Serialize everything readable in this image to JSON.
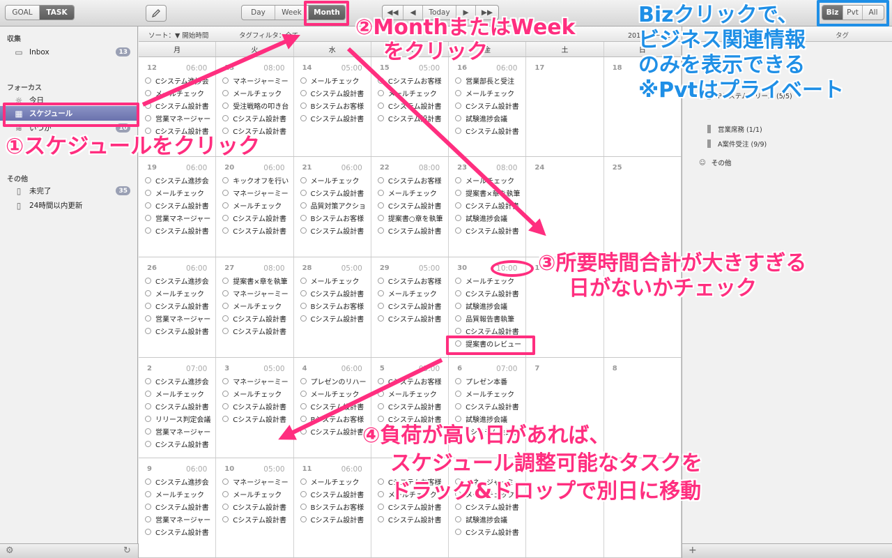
{
  "toolbar": {
    "goal": "GOAL",
    "task": "TASK",
    "views": [
      "Day",
      "Week",
      "Month"
    ],
    "today": "Today",
    "filters": [
      "Biz",
      "Pvt",
      "All"
    ]
  },
  "sidebar": {
    "section_collect": "収集",
    "inbox": {
      "label": "Inbox",
      "count": "13"
    },
    "section_focus": "フォーカス",
    "today": "今日",
    "schedule": "スケジュール",
    "someday": {
      "label": "いつか",
      "count": "10"
    },
    "section_other": "その他",
    "incomplete": {
      "label": "未完了",
      "count": "35"
    },
    "updated": "24時間以内更新"
  },
  "sortbar": {
    "sort": "ソート：▼ 開始時間",
    "tag_filter": "タグフィルタ：全て",
    "date": "2015－9－12"
  },
  "weekdays": [
    "月",
    "火",
    "水",
    "木",
    "金",
    "土",
    "日"
  ],
  "weeks": [
    {
      "days": [
        {
          "n": "12",
          "t": "06:00",
          "tasks": [
            "Cシステム進捗会",
            "メールチェック",
            "Cシステム設計書",
            "営業マネージャー",
            "Cシステム設計書"
          ]
        },
        {
          "n": "13",
          "t": "08:00",
          "tasks": [
            "マネージャーミー",
            "メールチェック",
            "受注戦略の叩き台",
            "Cシステム設計書",
            "Cシステム設計書"
          ]
        },
        {
          "n": "14",
          "t": "05:00",
          "tasks": [
            "メールチェック",
            "Cシステム設計書",
            "Bシステムお客様",
            "Cシステム設計書"
          ]
        },
        {
          "n": "15",
          "t": "05:00",
          "tasks": [
            "Cシステムお客様",
            "メールチェック",
            "Cシステム設計書",
            "Cシステム設計書"
          ]
        },
        {
          "n": "16",
          "t": "06:00",
          "tasks": [
            "営業部長と受注",
            "メールチェック",
            "Cシステム設計書",
            "試験進捗会議",
            "Cシステム設計書"
          ]
        },
        {
          "n": "17",
          "t": "",
          "tasks": []
        },
        {
          "n": "18",
          "t": "",
          "tasks": []
        }
      ]
    },
    {
      "days": [
        {
          "n": "19",
          "t": "06:00",
          "tasks": [
            "Cシステム進捗会",
            "メールチェック",
            "Cシステム設計書",
            "営業マネージャー",
            "Cシステム設計書"
          ]
        },
        {
          "n": "20",
          "t": "06:00",
          "tasks": [
            "キックオフを行い",
            "マネージャーミー",
            "メールチェック",
            "Cシステム設計書",
            "Cシステム設計書"
          ]
        },
        {
          "n": "21",
          "t": "06:00",
          "tasks": [
            "メールチェック",
            "Cシステム設計書",
            "品質対策アクショ",
            "Bシステムお客様",
            "Cシステム設計書"
          ]
        },
        {
          "n": "22",
          "t": "08:00",
          "tasks": [
            "Cシステムお客様",
            "メールチェック",
            "Cシステム設計書",
            "提案書○章を執筆",
            "Cシステム設計書"
          ]
        },
        {
          "n": "23",
          "t": "08:00",
          "tasks": [
            "メールチェック",
            "提案書×章を執筆",
            "Cシステム設計書",
            "試験進捗会議",
            "Cシステム設計書"
          ]
        },
        {
          "n": "24",
          "t": "",
          "tasks": []
        },
        {
          "n": "25",
          "t": "",
          "tasks": []
        }
      ]
    },
    {
      "days": [
        {
          "n": "26",
          "t": "06:00",
          "tasks": [
            "Cシステム進捗会",
            "メールチェック",
            "Cシステム設計書",
            "営業マネージャー",
            "Cシステム設計書"
          ]
        },
        {
          "n": "27",
          "t": "08:00",
          "tasks": [
            "提案書×章を執筆",
            "マネージャーミー",
            "メールチェック",
            "Cシステム設計書",
            "Cシステム設計書"
          ]
        },
        {
          "n": "28",
          "t": "05:00",
          "tasks": [
            "メールチェック",
            "Cシステム設計書",
            "Bシステムお客様",
            "Cシステム設計書"
          ]
        },
        {
          "n": "29",
          "t": "05:00",
          "tasks": [
            "Cシステムお客様",
            "メールチェック",
            "Cシステム設計書",
            "Cシステム設計書"
          ]
        },
        {
          "n": "30",
          "t": "10:00",
          "tasks": [
            "メールチェック",
            "Cシステム設計書",
            "試験進捗会議",
            "品質報告書執筆",
            "Cシステム設計書",
            "提案書のレビュー"
          ]
        },
        {
          "n": "1",
          "t": "",
          "tasks": []
        },
        {
          "n": "",
          "t": "",
          "tasks": []
        }
      ]
    },
    {
      "days": [
        {
          "n": "2",
          "t": "07:00",
          "tasks": [
            "Cシステム進捗会",
            "メールチェック",
            "Cシステム設計書",
            "リリース判定会議",
            "営業マネージャー",
            "Cシステム設計書"
          ]
        },
        {
          "n": "3",
          "t": "05:00",
          "tasks": [
            "マネージャーミー",
            "メールチェック",
            "Cシステム設計書",
            "Cシステム設計書"
          ]
        },
        {
          "n": "4",
          "t": "06:00",
          "tasks": [
            "プレゼンのリハー",
            "メールチェック",
            "Cシステム設計書",
            "Bシステムお客様",
            "Cシステム設計書"
          ]
        },
        {
          "n": "5",
          "t": "05:00",
          "tasks": [
            "Cシステムお客様",
            "メールチェック",
            "Cシステム設計書",
            "Cシステム設計書"
          ]
        },
        {
          "n": "6",
          "t": "07:00",
          "tasks": [
            "プレゼン本番",
            "メールチェック",
            "Cシステム設計書",
            "試験進捗会議",
            "Cシステム設計書"
          ]
        },
        {
          "n": "7",
          "t": "",
          "tasks": []
        },
        {
          "n": "8",
          "t": "",
          "tasks": []
        }
      ]
    },
    {
      "days": [
        {
          "n": "9",
          "t": "06:00",
          "tasks": [
            "Cシステム進捗会",
            "メールチェック",
            "Cシステム設計書",
            "営業マネージャー",
            "Cシステム設計書"
          ]
        },
        {
          "n": "10",
          "t": "05:00",
          "tasks": [
            "マネージャーミー",
            "メールチェック",
            "Cシステム設計書",
            "Cシステム設計書"
          ]
        },
        {
          "n": "11",
          "t": "06:00",
          "tasks": [
            "メールチェック",
            "Cシステム設計書",
            "Bシステムお客様",
            "Cシステム設計書"
          ]
        },
        {
          "n": "",
          "t": "",
          "tasks": [
            "Cシステムお客様",
            "メールチェック",
            "Cシステム設計書",
            "Cシステム設計書"
          ]
        },
        {
          "n": "",
          "t": "",
          "tasks": [
            "マネージャーミー",
            "メールチェック",
            "Cシステム設計書",
            "試験進捗会議",
            "Cシステム設計書"
          ]
        },
        {
          "n": "",
          "t": "",
          "tasks": []
        },
        {
          "n": "",
          "t": "",
          "tasks": []
        }
      ]
    }
  ],
  "right_panel": {
    "header_left": "ゴール",
    "header_right": "タグ",
    "tags": [
      {
        "label": "Pシステムリリース (5/5)"
      },
      {
        "label": "営業席務 (1/1)"
      },
      {
        "label": "A案件受注 (9/9)"
      }
    ],
    "other": "その他"
  },
  "annotations": {
    "a1": "①スケジュールをクリック",
    "a2_line1": "②MonthまたはWeek",
    "a2_line2": "をクリック",
    "a3_line1": "③所要時間合計が大きすぎる",
    "a3_line2": "日がないかチェック",
    "a4_line1": "④負荷が高い日があれば、",
    "a4_line2": "スケジュール調整可能なタスクを",
    "a4_line3": "ドラッグ&ドロップで別日に移動",
    "biz_line1": "Bizクリックで、",
    "biz_line2": "ビジネス関連情報",
    "biz_line3": "のみを表示できる",
    "biz_line4": "※Pvtはプライベート"
  },
  "colors": {
    "annotation_pink": "#ff2e7f",
    "annotation_blue": "#1f8fe6",
    "selection": "#7a82b9"
  }
}
